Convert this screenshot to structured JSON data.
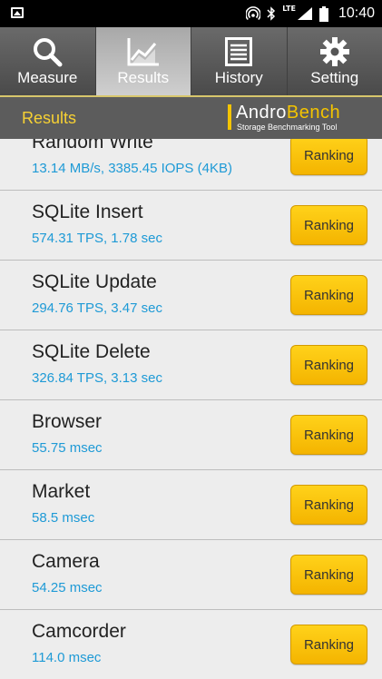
{
  "status_bar": {
    "time": "10:40",
    "network_label": "LTE"
  },
  "tabs": [
    {
      "label": "Measure",
      "icon": "magnifier-icon",
      "active": false
    },
    {
      "label": "Results",
      "icon": "chart-icon",
      "active": true
    },
    {
      "label": "History",
      "icon": "list-icon",
      "active": false
    },
    {
      "label": "Setting",
      "icon": "gear-icon",
      "active": false
    }
  ],
  "header": {
    "title": "Results",
    "logo_name_prefix": "Andro",
    "logo_name_suffix": "Bench",
    "logo_tagline": "Storage Benchmarking Tool"
  },
  "ranking_label": "Ranking",
  "results": [
    {
      "name": "Random Write",
      "value": "13.14 MB/s, 3385.45 IOPS (4KB)"
    },
    {
      "name": "SQLite Insert",
      "value": "574.31 TPS, 1.78 sec"
    },
    {
      "name": "SQLite Update",
      "value": "294.76 TPS, 3.47 sec"
    },
    {
      "name": "SQLite Delete",
      "value": "326.84 TPS, 3.13 sec"
    },
    {
      "name": "Browser",
      "value": "55.75 msec"
    },
    {
      "name": "Market",
      "value": "58.5 msec"
    },
    {
      "name": "Camera",
      "value": "54.25 msec"
    },
    {
      "name": "Camcorder",
      "value": "114.0 msec"
    }
  ],
  "colors": {
    "accent": "#f7d133",
    "value_text": "#1e9ad6",
    "button": "#f4b400"
  }
}
